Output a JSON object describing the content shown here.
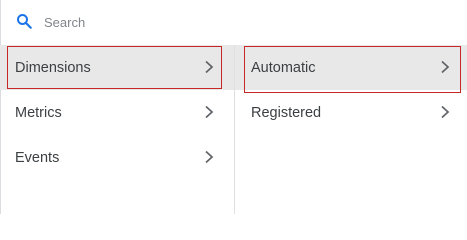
{
  "search": {
    "placeholder": "Search",
    "icon": "search-icon",
    "icon_color": "#1a73e8"
  },
  "menu_left": {
    "items": [
      {
        "label": "Dimensions",
        "selected": true
      },
      {
        "label": "Metrics",
        "selected": false
      },
      {
        "label": "Events",
        "selected": false
      }
    ]
  },
  "menu_right": {
    "items": [
      {
        "label": "Automatic",
        "selected": true
      },
      {
        "label": "Registered",
        "selected": false
      }
    ]
  },
  "colors": {
    "selected_background": "#e8e8e8",
    "highlight_border": "#c62828",
    "chevron": "#5f6368"
  }
}
